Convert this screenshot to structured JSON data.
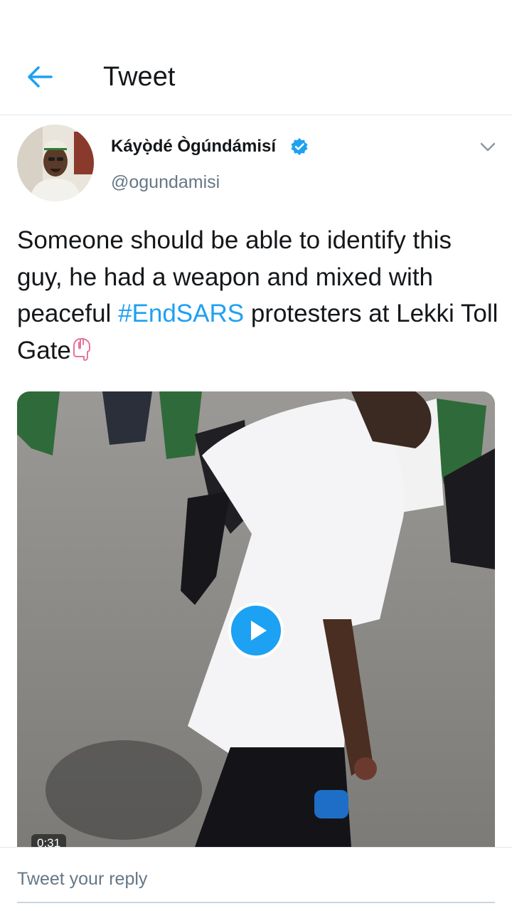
{
  "header": {
    "title": "Tweet",
    "back_icon": "arrow-left-icon"
  },
  "tweet": {
    "author_name": "Káyọ̀dé Ògúndámisí",
    "handle": "@ogundamisi",
    "verified_icon": "verified-badge-icon",
    "menu_icon": "chevron-down-icon",
    "text_before_hashtag": "Someone should be able to identify this guy, he had a weapon and mixed with peaceful ",
    "hashtag": "#EndSARS",
    "text_after_hashtag": " protesters at Lekki Toll Gate",
    "emoji_icon": "backhand-index-pointing-down-icon"
  },
  "media": {
    "play_icon": "play-icon",
    "duration": "0:31"
  },
  "reply": {
    "placeholder": "Tweet your reply"
  },
  "colors": {
    "accent": "#1da1f2",
    "text_primary": "#14171a",
    "text_secondary": "#657786",
    "divider": "#e1e8ed",
    "emoji_pink": "#e8739a"
  }
}
